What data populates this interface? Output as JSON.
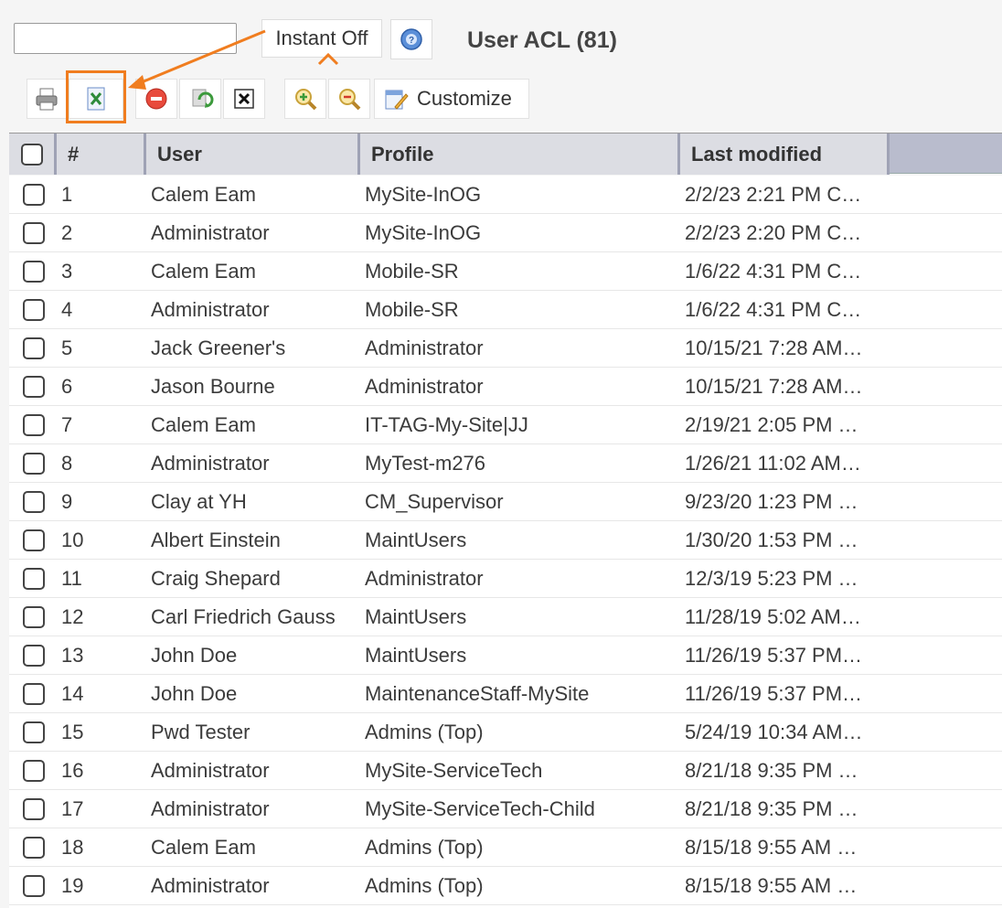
{
  "search": {
    "placeholder": "",
    "value": ""
  },
  "instant_toggle": {
    "label": "Instant Off"
  },
  "page_title": "User ACL (81)",
  "toolbar": {
    "customize_label": "Customize"
  },
  "highlight_color": "#f07d1f",
  "columns": [
    "#",
    "User",
    "Profile",
    "Last modified"
  ],
  "rows": [
    {
      "num": "1",
      "user": "Calem Eam",
      "profile": "MySite-InOG",
      "modified": "2/2/23 2:21 PM C…"
    },
    {
      "num": "2",
      "user": "Administrator",
      "profile": "MySite-InOG",
      "modified": "2/2/23 2:20 PM C…"
    },
    {
      "num": "3",
      "user": "Calem Eam",
      "profile": "Mobile-SR",
      "modified": "1/6/22 4:31 PM C…"
    },
    {
      "num": "4",
      "user": "Administrator",
      "profile": "Mobile-SR",
      "modified": "1/6/22 4:31 PM C…"
    },
    {
      "num": "5",
      "user": "Jack Greener's",
      "profile": "Administrator",
      "modified": "10/15/21 7:28 AM…"
    },
    {
      "num": "6",
      "user": "Jason Bourne",
      "profile": "Administrator",
      "modified": "10/15/21 7:28 AM…"
    },
    {
      "num": "7",
      "user": "Calem Eam",
      "profile": "IT-TAG-My-Site|JJ",
      "modified": "2/19/21 2:05 PM …"
    },
    {
      "num": "8",
      "user": "Administrator",
      "profile": "MyTest-m276",
      "modified": "1/26/21 11:02 AM…"
    },
    {
      "num": "9",
      "user": "Clay at YH",
      "profile": "CM_Supervisor",
      "modified": "9/23/20 1:23 PM …"
    },
    {
      "num": "10",
      "user": "Albert Einstein",
      "profile": "MaintUsers",
      "modified": "1/30/20 1:53 PM …"
    },
    {
      "num": "11",
      "user": "Craig Shepard",
      "profile": "Administrator",
      "modified": "12/3/19 5:23 PM …"
    },
    {
      "num": "12",
      "user": "Carl Friedrich Gauss",
      "profile": "MaintUsers",
      "modified": "11/28/19 5:02 AM…"
    },
    {
      "num": "13",
      "user": "John Doe",
      "profile": "MaintUsers",
      "modified": "11/26/19 5:37 PM…"
    },
    {
      "num": "14",
      "user": "John Doe",
      "profile": "MaintenanceStaff-MySite",
      "modified": "11/26/19 5:37 PM…"
    },
    {
      "num": "15",
      "user": "Pwd Tester",
      "profile": "Admins (Top)",
      "modified": "5/24/19 10:34 AM…"
    },
    {
      "num": "16",
      "user": "Administrator",
      "profile": "MySite-ServiceTech",
      "modified": "8/21/18 9:35 PM …"
    },
    {
      "num": "17",
      "user": "Administrator",
      "profile": "MySite-ServiceTech-Child",
      "modified": "8/21/18 9:35 PM …"
    },
    {
      "num": "18",
      "user": "Calem Eam",
      "profile": "Admins (Top)",
      "modified": "8/15/18 9:55 AM …"
    },
    {
      "num": "19",
      "user": "Administrator",
      "profile": "Admins (Top)",
      "modified": "8/15/18 9:55 AM …"
    }
  ]
}
